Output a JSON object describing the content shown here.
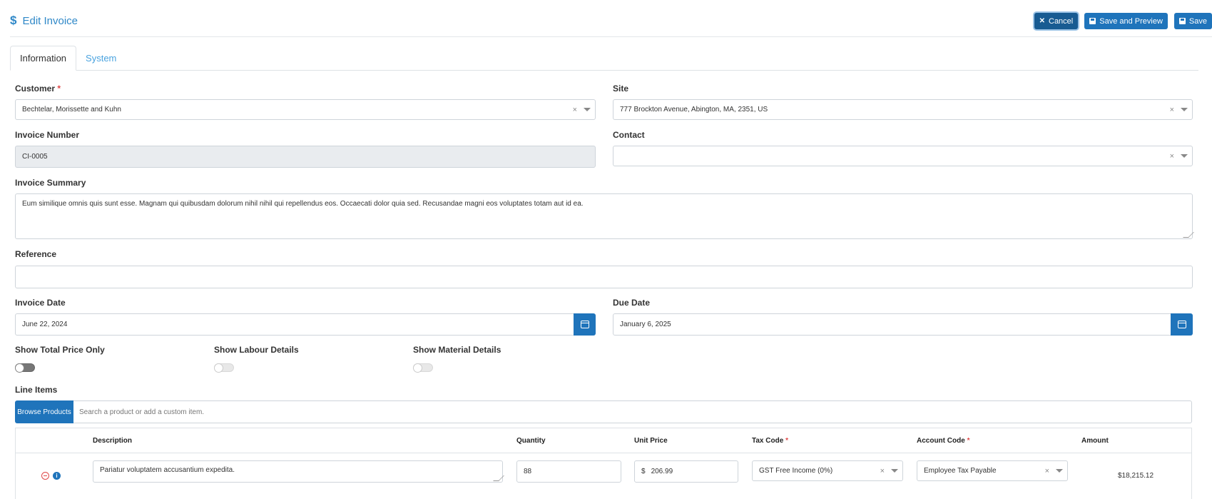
{
  "header": {
    "title": "Edit Invoice",
    "buttons": {
      "cancel": "Cancel",
      "save_preview": "Save and Preview",
      "save": "Save"
    }
  },
  "tabs": [
    "Information",
    "System"
  ],
  "form": {
    "customer": {
      "label": "Customer",
      "value": "Bechtelar, Morissette and Kuhn"
    },
    "site": {
      "label": "Site",
      "value": "777 Brockton Avenue, Abington, MA, 2351, US"
    },
    "invoice_number": {
      "label": "Invoice Number",
      "value": "CI-0005"
    },
    "contact": {
      "label": "Contact",
      "value": ""
    },
    "invoice_summary": {
      "label": "Invoice Summary",
      "value": "Eum similique omnis quis sunt esse. Magnam qui quibusdam dolorum nihil nihil qui repellendus eos. Occaecati dolor quia sed. Recusandae magni eos voluptates totam aut id ea."
    },
    "reference": {
      "label": "Reference",
      "value": ""
    },
    "invoice_date": {
      "label": "Invoice Date",
      "value": "June 22, 2024"
    },
    "due_date": {
      "label": "Due Date",
      "value": "January 6, 2025"
    },
    "toggles": {
      "total_price": {
        "label": "Show Total Price Only",
        "on": false
      },
      "labour": {
        "label": "Show Labour Details",
        "on": false
      },
      "material": {
        "label": "Show Material Details",
        "on": false
      }
    }
  },
  "line_items": {
    "label": "Line Items",
    "browse_label": "Browse Products",
    "search_placeholder": "Search a product or add a custom item.",
    "columns": {
      "description": "Description",
      "quantity": "Quantity",
      "unit_price": "Unit Price",
      "tax_code": "Tax Code",
      "account_code": "Account Code",
      "amount": "Amount"
    },
    "rows": [
      {
        "description": "Pariatur voluptatem accusantium expedita.",
        "quantity": "88",
        "currency": "$",
        "unit_price": "206.99",
        "tax_code": "GST Free Income (0%)",
        "account_code": "Employee Tax Payable",
        "amount": "$18,215.12"
      }
    ]
  },
  "colors": {
    "primary": "#1f74bb",
    "link": "#2f88c8",
    "required": "#e04848"
  }
}
